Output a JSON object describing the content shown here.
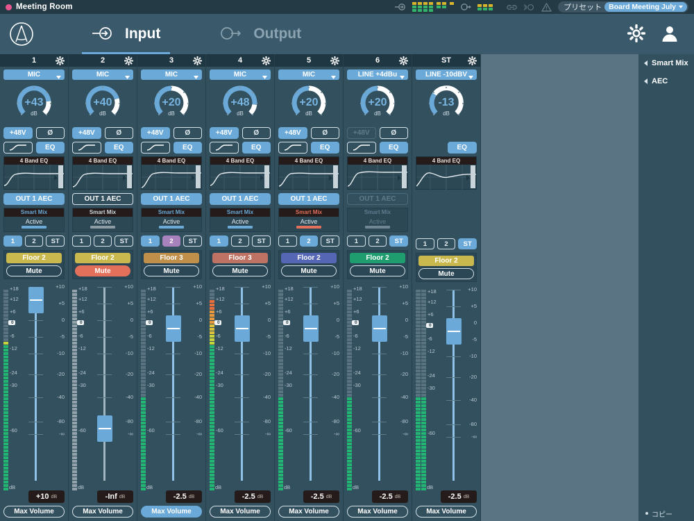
{
  "titlebar": {
    "room_name": "Meeting Room",
    "status_dot_color": "#e8558f",
    "input_meter_icon": "input-meter-icon",
    "output_meter_icon": "output-meter-icon",
    "link_icon": "link-icon",
    "wireless_icon": "wireless-icon",
    "warning_icon": "warning-icon",
    "preset_label": "プリセット",
    "preset_value": "Board Meeting July"
  },
  "nav": {
    "logo": "audio-technica-logo",
    "tabs": [
      {
        "label": "Input",
        "icon": "input-arrow-icon",
        "active": true
      },
      {
        "label": "Output",
        "icon": "output-arrow-icon",
        "active": false
      }
    ],
    "settings_icon": "gear-icon",
    "user_icon": "user-icon"
  },
  "sidepanel": {
    "items": [
      {
        "label": "Smart Mix",
        "icon": "chevron-left-icon"
      },
      {
        "label": "AEC",
        "icon": "chevron-left-icon"
      }
    ],
    "copy_label": "コピー"
  },
  "labels": {
    "db_unit": "dB",
    "eq_title": "4 Band EQ",
    "smartmix_title": "Smart Mix",
    "smartmix_state": "Active",
    "phantom": "+48V",
    "polarity": "Ø",
    "hpf": "hpf-curve-icon",
    "eq": "EQ",
    "mute": "Mute",
    "max_volume": "Max Volume",
    "out_aec": "OUT 1 AEC"
  },
  "scales": {
    "meter_ticks": [
      "+18",
      "+12",
      "+6",
      "-6",
      "-12",
      "-24",
      "-30",
      "-60"
    ],
    "meter_zero": "0",
    "fader_ticks": [
      "+10",
      "+5",
      "0",
      "-5",
      "-10",
      "-20",
      "-40",
      "-80",
      "-∞"
    ]
  },
  "channels": [
    {
      "num": "1",
      "input_type": "MIC",
      "gain": "+43",
      "gain_pct": 62,
      "phantom": "on",
      "polarity": "off",
      "hpf": "off",
      "eq": "on",
      "out_aec": "on",
      "smartmix": "on",
      "smartmix_color": "#6aa9d8",
      "routes": [
        {
          "label": "1",
          "state": "on"
        },
        {
          "label": "2",
          "state": "off"
        },
        {
          "label": "ST",
          "state": "off"
        }
      ],
      "name": "Floor 2",
      "name_color": "#c9b84e",
      "mute": "off",
      "fader_db": "+10",
      "fader_pct": 100,
      "max_volume": "off",
      "meter_level": 74,
      "meter_muted": false,
      "stereo": false
    },
    {
      "num": "2",
      "input_type": "MIC",
      "gain": "+40",
      "gain_pct": 55,
      "phantom": "on",
      "polarity": "off",
      "hpf": "off",
      "eq": "on",
      "out_aec": "off",
      "smartmix": "off",
      "smartmix_color": "#8d9ba3",
      "routes": [
        {
          "label": "1",
          "state": "off"
        },
        {
          "label": "2",
          "state": "off"
        },
        {
          "label": "ST",
          "state": "off"
        }
      ],
      "name": "Floor 2",
      "name_color": "#c9b84e",
      "mute": "on",
      "fader_db": "-Inf",
      "fader_pct": 0,
      "max_volume": "off",
      "meter_level": 0,
      "meter_muted": true,
      "stereo": false
    },
    {
      "num": "3",
      "input_type": "MIC",
      "gain": "+20",
      "gain_pct": 0,
      "phantom": "on",
      "polarity": "off",
      "hpf": "off",
      "eq": "on",
      "out_aec": "on",
      "smartmix": "on",
      "smartmix_color": "#6aa9d8",
      "routes": [
        {
          "label": "1",
          "state": "on"
        },
        {
          "label": "2",
          "state": "on2"
        },
        {
          "label": "ST",
          "state": "off"
        }
      ],
      "name": "Floor 3",
      "name_color": "#c08f4a",
      "mute": "off",
      "fader_db": "-2.5",
      "fader_pct": 78,
      "max_volume": "on",
      "meter_level": 47,
      "meter_muted": false,
      "stereo": false
    },
    {
      "num": "4",
      "input_type": "MIC",
      "gain": "+48",
      "gain_pct": 72,
      "phantom": "on",
      "polarity": "off",
      "hpf": "off",
      "eq": "on",
      "out_aec": "on",
      "smartmix": "on",
      "smartmix_color": "#6aa9d8",
      "routes": [
        {
          "label": "1",
          "state": "on"
        },
        {
          "label": "2",
          "state": "off"
        },
        {
          "label": "ST",
          "state": "off"
        }
      ],
      "name": "Floor 3",
      "name_color": "#bd7264",
      "mute": "off",
      "fader_db": "-2.5",
      "fader_pct": 78,
      "max_volume": "off",
      "meter_level": 95,
      "meter_muted": false,
      "stereo": false
    },
    {
      "num": "5",
      "input_type": "MIC",
      "gain": "+20",
      "gain_pct": 0,
      "phantom": "on",
      "polarity": "off",
      "hpf": "off",
      "eq": "on",
      "out_aec": "on",
      "smartmix": "on",
      "smartmix_color": "#e2705a",
      "routes": [
        {
          "label": "1",
          "state": "off"
        },
        {
          "label": "2",
          "state": "on"
        },
        {
          "label": "ST",
          "state": "off"
        }
      ],
      "name": "Floor 2",
      "name_color": "#5566b5",
      "mute": "off",
      "fader_db": "-2.5",
      "fader_pct": 78,
      "max_volume": "off",
      "meter_level": 47,
      "meter_muted": false,
      "stereo": false
    },
    {
      "num": "6",
      "input_type": "LINE +4dBu",
      "gain": "+20",
      "gain_pct": 0,
      "phantom": "dis",
      "polarity": "off",
      "hpf": "off",
      "eq": "on",
      "out_aec": "dis",
      "smartmix": "dis",
      "smartmix_color": "#8d9ba3",
      "routes": [
        {
          "label": "1",
          "state": "off"
        },
        {
          "label": "2",
          "state": "off"
        },
        {
          "label": "ST",
          "state": "on"
        }
      ],
      "name": "Floor 2",
      "name_color": "#1f9d6e",
      "mute": "off",
      "fader_db": "-2.5",
      "fader_pct": 78,
      "max_volume": "off",
      "meter_level": 47,
      "meter_muted": false,
      "stereo": false
    },
    {
      "num": "ST",
      "input_type": "LINE -10dBV",
      "gain": "-13",
      "gain_pct": -40,
      "phantom": "none",
      "polarity": "none",
      "hpf": "none",
      "eq": "on",
      "out_aec": "none",
      "smartmix": "none",
      "smartmix_color": "#6aa9d8",
      "routes": [
        {
          "label": "1",
          "state": "off"
        },
        {
          "label": "2",
          "state": "off"
        },
        {
          "label": "ST",
          "state": "on"
        }
      ],
      "name": "Floor 2",
      "name_color": "#c9b84e",
      "mute": "off",
      "fader_db": "-2.5",
      "fader_pct": 78,
      "max_volume": "off",
      "meter_level": 47,
      "meter_muted": false,
      "stereo": true
    }
  ]
}
